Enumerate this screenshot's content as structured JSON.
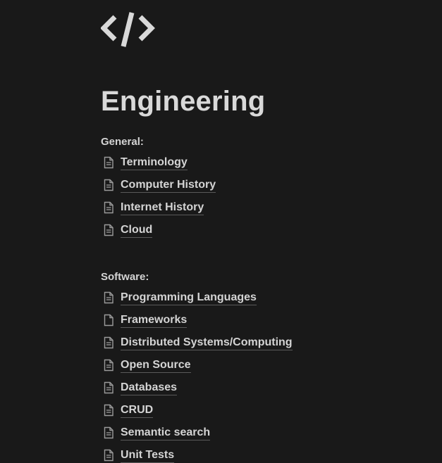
{
  "page": {
    "icon": "code-brackets-icon",
    "title": "Engineering"
  },
  "sections": [
    {
      "heading": "General:",
      "items": [
        {
          "label": "Terminology",
          "icon": "document-icon"
        },
        {
          "label": "Computer History",
          "icon": "document-icon"
        },
        {
          "label": "Internet History",
          "icon": "document-icon"
        },
        {
          "label": "Cloud",
          "icon": "document-icon"
        }
      ]
    },
    {
      "heading": "Software:",
      "items": [
        {
          "label": "Programming Languages",
          "icon": "document-icon"
        },
        {
          "label": "Frameworks",
          "icon": "blank-document-icon"
        },
        {
          "label": "Distributed Systems/Computing",
          "icon": "document-icon"
        },
        {
          "label": "Open Source",
          "icon": "document-icon"
        },
        {
          "label": "Databases",
          "icon": "document-icon"
        },
        {
          "label": "CRUD",
          "icon": "document-icon"
        },
        {
          "label": "Semantic search",
          "icon": "document-icon"
        },
        {
          "label": "Unit Tests",
          "icon": "document-icon"
        }
      ]
    }
  ],
  "colors": {
    "background": "#191919",
    "text": "#d4d4d4",
    "underline": "#5a5a5a",
    "icon": "#9b9b9b"
  }
}
